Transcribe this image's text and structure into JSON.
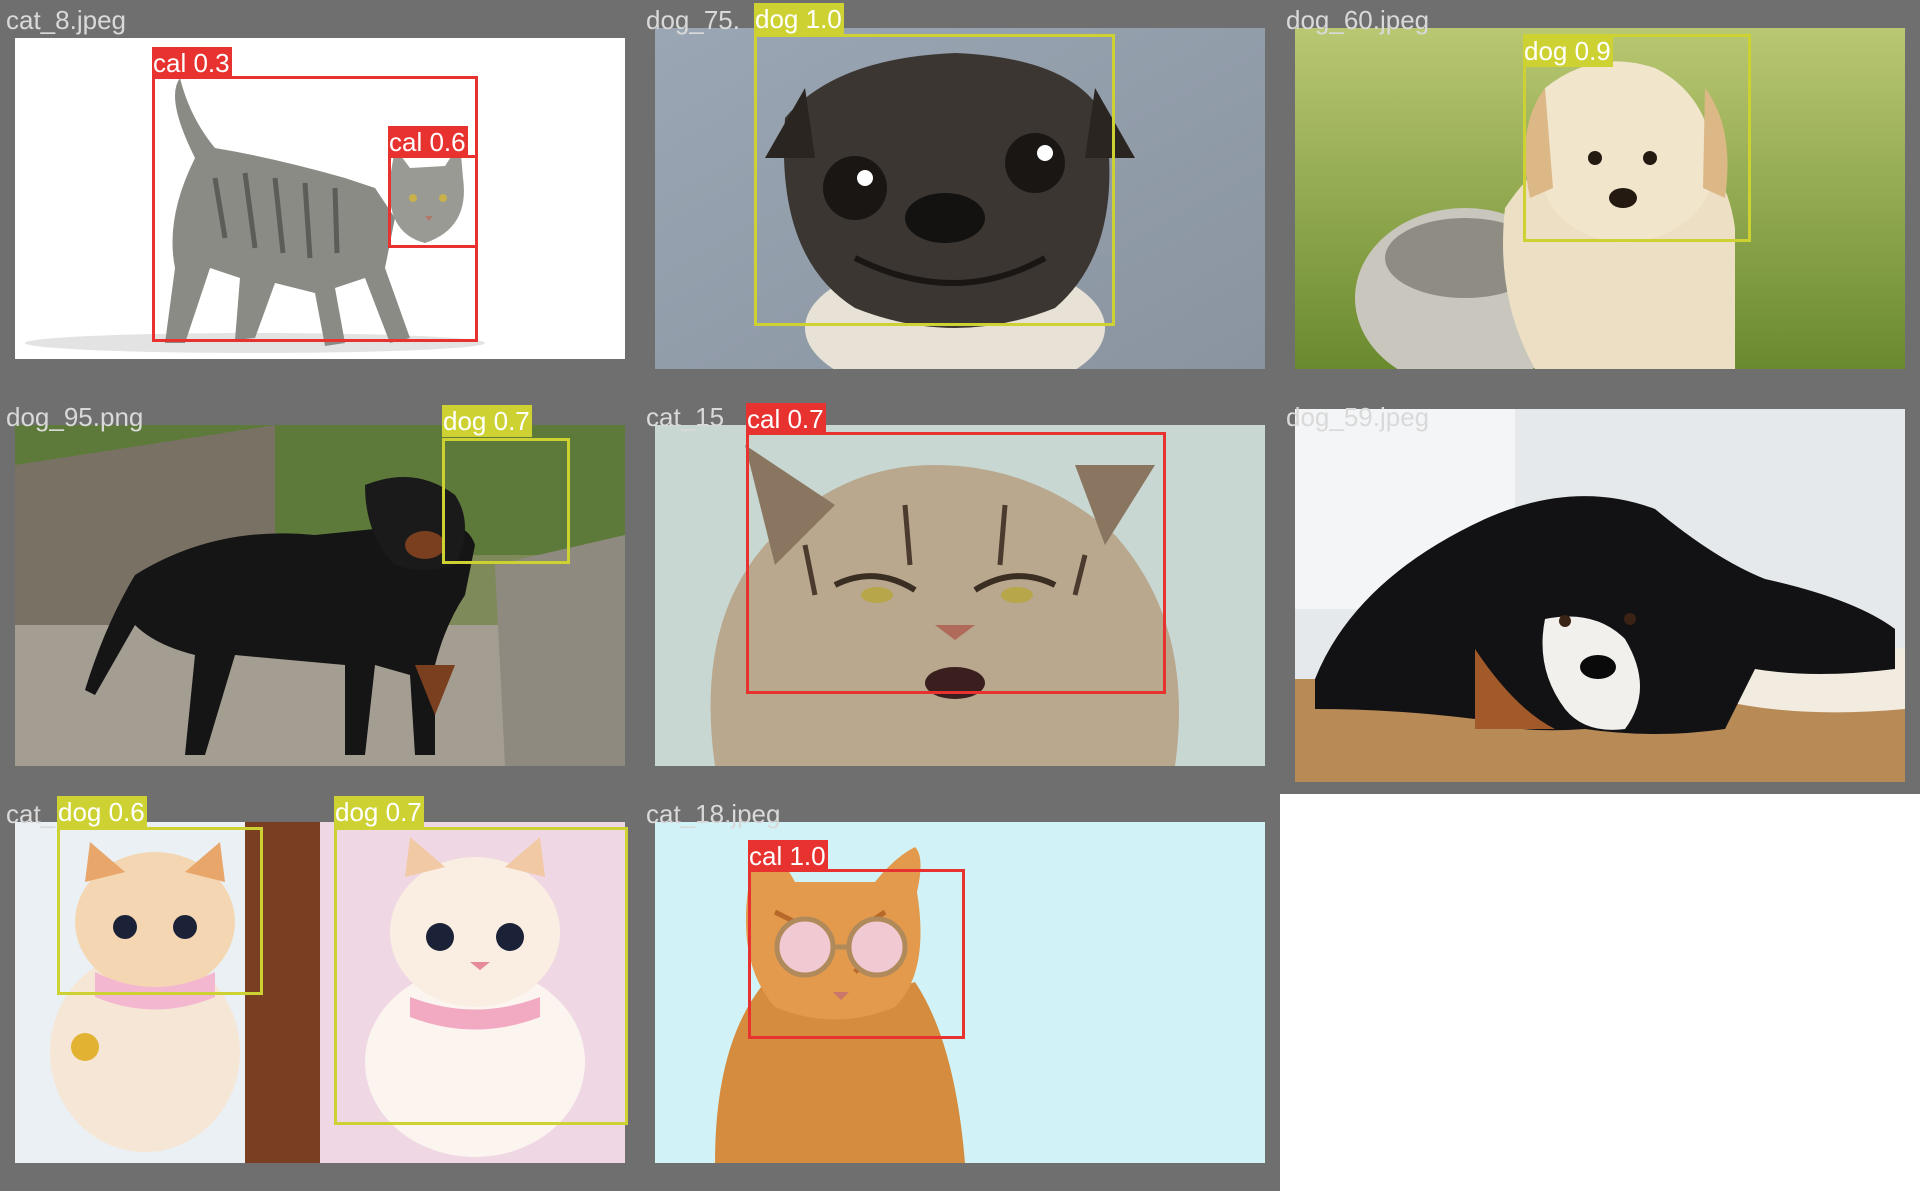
{
  "colors": {
    "cat_box": "#e8322f",
    "dog_box": "#cdd232",
    "tile_bg": "#6f6f6f",
    "filename_text": "#d9d9d9",
    "tag_text": "#ffffff"
  },
  "tiles": [
    {
      "filename": "cat_8.jpeg",
      "image": "photo of a grey tabby cat walking on white background",
      "detections": [
        {
          "label": "cal 0.3",
          "class": "cat"
        },
        {
          "label": "cal 0.6",
          "class": "cat"
        }
      ]
    },
    {
      "filename": "dog_75.",
      "image": "close-up photo of a pug",
      "detections": [
        {
          "label": "dog 1.0",
          "class": "dog"
        }
      ]
    },
    {
      "filename": "dog_60.jpeg",
      "image": "golden retriever puppy sitting in a bowl on grass",
      "detections": [
        {
          "label": "dog 0.9",
          "class": "dog"
        }
      ]
    },
    {
      "filename": "dog_95.png",
      "image": "rottweiler standing on a path",
      "detections": [
        {
          "label": "dog 0.7",
          "class": "dog"
        }
      ]
    },
    {
      "filename": "cat_15",
      "image": "close-up of a grumpy long-haired cat",
      "detections": [
        {
          "label": "cal 0.7",
          "class": "cat"
        }
      ]
    },
    {
      "filename": "dog_59.jpeg",
      "image": "bernese mountain dog lying on a wooden floor",
      "detections": []
    },
    {
      "filename": "cat_",
      "image": "two white and ginger kittens",
      "detections": [
        {
          "label": "dog 0.6",
          "class": "dog"
        },
        {
          "label": "dog 0.7",
          "class": "dog"
        }
      ]
    },
    {
      "filename": "cat_18.jpeg",
      "image": "ginger cat wearing round sunglasses on light blue background",
      "detections": [
        {
          "label": "cal 1.0",
          "class": "cat"
        }
      ]
    }
  ]
}
